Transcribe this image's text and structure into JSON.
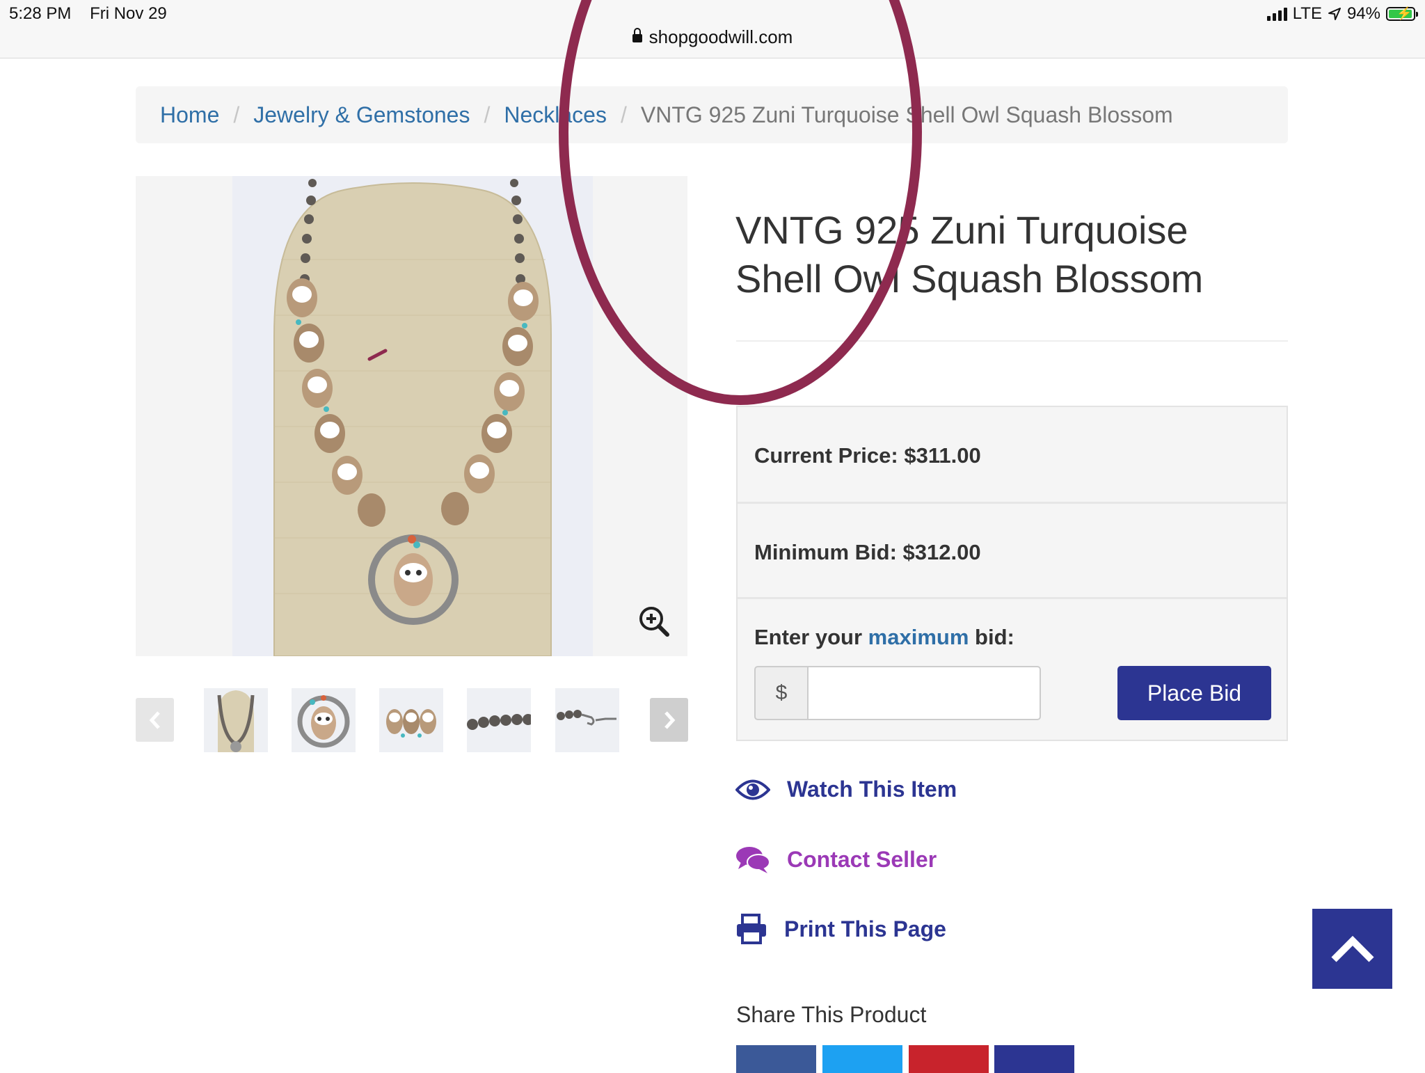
{
  "status_bar": {
    "time": "5:28 PM",
    "date": "Fri Nov 29",
    "carrier": "LTE",
    "battery": "94%",
    "battery_level": 0.94,
    "url": "shopgoodwill.com"
  },
  "breadcrumb": [
    {
      "label": "Home"
    },
    {
      "label": "Jewelry & Gemstones"
    },
    {
      "label": "Necklaces"
    },
    {
      "label": "VNTG 925 Zuni Turquoise Shell Owl Squash Blossom"
    }
  ],
  "breadcrumb_separator": "/",
  "product": {
    "title": "VNTG 925 Zuni Turquoise Shell Owl Squash Blossom"
  },
  "bid": {
    "current_price": "Current Price: $311.00",
    "minimum_bid": "Minimum Bid: $312.00",
    "enter_prefix": "Enter your",
    "enter_max": "maximum",
    "enter_suffix": "bid:",
    "currency_symbol": "$",
    "input_value": "",
    "place_bid": "Place Bid"
  },
  "actions": {
    "watch": "Watch This Item",
    "contact": "Contact Seller",
    "print": "Print This Page"
  },
  "share": {
    "title": "Share This Product"
  },
  "icons": {
    "zoom": "zoom-in-icon",
    "prev": "chevron-left-icon",
    "next": "chevron-right-icon",
    "watch": "eye-icon",
    "contact": "comments-icon",
    "print": "printer-icon",
    "back_to_top": "chevron-up-icon"
  },
  "colors": {
    "link": "#2f6fa7",
    "primary": "#2c3592",
    "contact": "#9b39b6",
    "annotation": "#8e2a4f"
  }
}
